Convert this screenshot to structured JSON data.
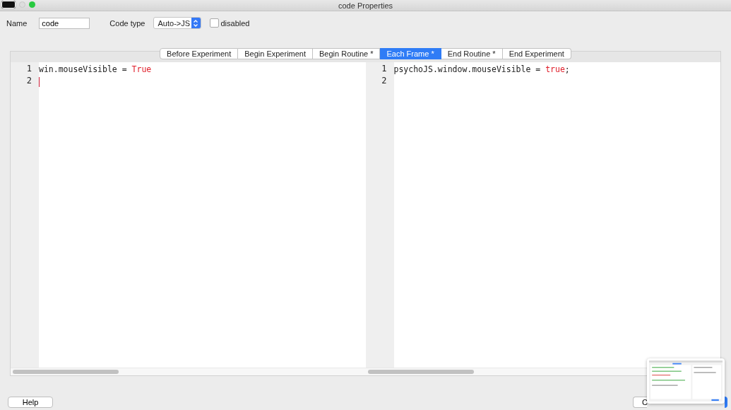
{
  "window": {
    "title": "code Properties"
  },
  "form": {
    "name_label": "Name",
    "name_value": "code",
    "code_type_label": "Code type",
    "code_type_value": "Auto->JS",
    "disabled_label": "disabled",
    "disabled_checked": false
  },
  "tabs": [
    {
      "label": "Before Experiment",
      "selected": false
    },
    {
      "label": "Begin Experiment",
      "selected": false
    },
    {
      "label": "Begin Routine *",
      "selected": false
    },
    {
      "label": "Each Frame *",
      "selected": true
    },
    {
      "label": "End Routine *",
      "selected": false
    },
    {
      "label": "End Experiment",
      "selected": false
    }
  ],
  "editors": [
    {
      "lines": [
        {
          "number": "1",
          "tokens": [
            {
              "text": "win.mouseVisible = ",
              "kind": "plain"
            },
            {
              "text": "True",
              "kind": "keyword"
            }
          ],
          "cursor": false
        },
        {
          "number": "2",
          "cursor": true
        }
      ]
    },
    {
      "lines": [
        {
          "number": "1",
          "tokens": [
            {
              "text": "psychoJS.window.mouseVisible = ",
              "kind": "plain"
            },
            {
              "text": "true",
              "kind": "keyword"
            },
            {
              "text": ";",
              "kind": "plain"
            }
          ],
          "cursor": false
        },
        {
          "number": "2",
          "cursor": false
        }
      ]
    }
  ],
  "buttons": {
    "help": "Help",
    "cancel": "C"
  }
}
